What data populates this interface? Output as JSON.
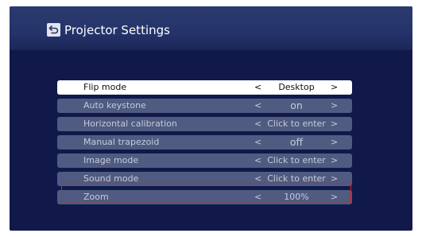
{
  "header": {
    "title": "Projector Settings",
    "back_icon": "back-arrow-icon"
  },
  "menu": {
    "items": [
      {
        "label": "Flip mode",
        "value": "Desktop",
        "selected": true
      },
      {
        "label": "Auto keystone",
        "value": "on",
        "selected": false
      },
      {
        "label": "Horizontal calibration",
        "value": "Click to enter",
        "selected": false
      },
      {
        "label": "Manual trapezoid",
        "value": "off",
        "selected": false
      },
      {
        "label": "Image mode",
        "value": "Click to enter",
        "selected": false
      },
      {
        "label": "Sound mode",
        "value": "Click to enter",
        "selected": false
      },
      {
        "label": "Zoom",
        "value": "100%",
        "selected": false,
        "highlighted": true
      }
    ],
    "prev_arrow": "<",
    "next_arrow": ">"
  },
  "colors": {
    "background": "#11194a",
    "header": "#24336a",
    "row": "#4f5b80",
    "selected_row": "#ffffff",
    "highlight_border": "#e02020"
  }
}
